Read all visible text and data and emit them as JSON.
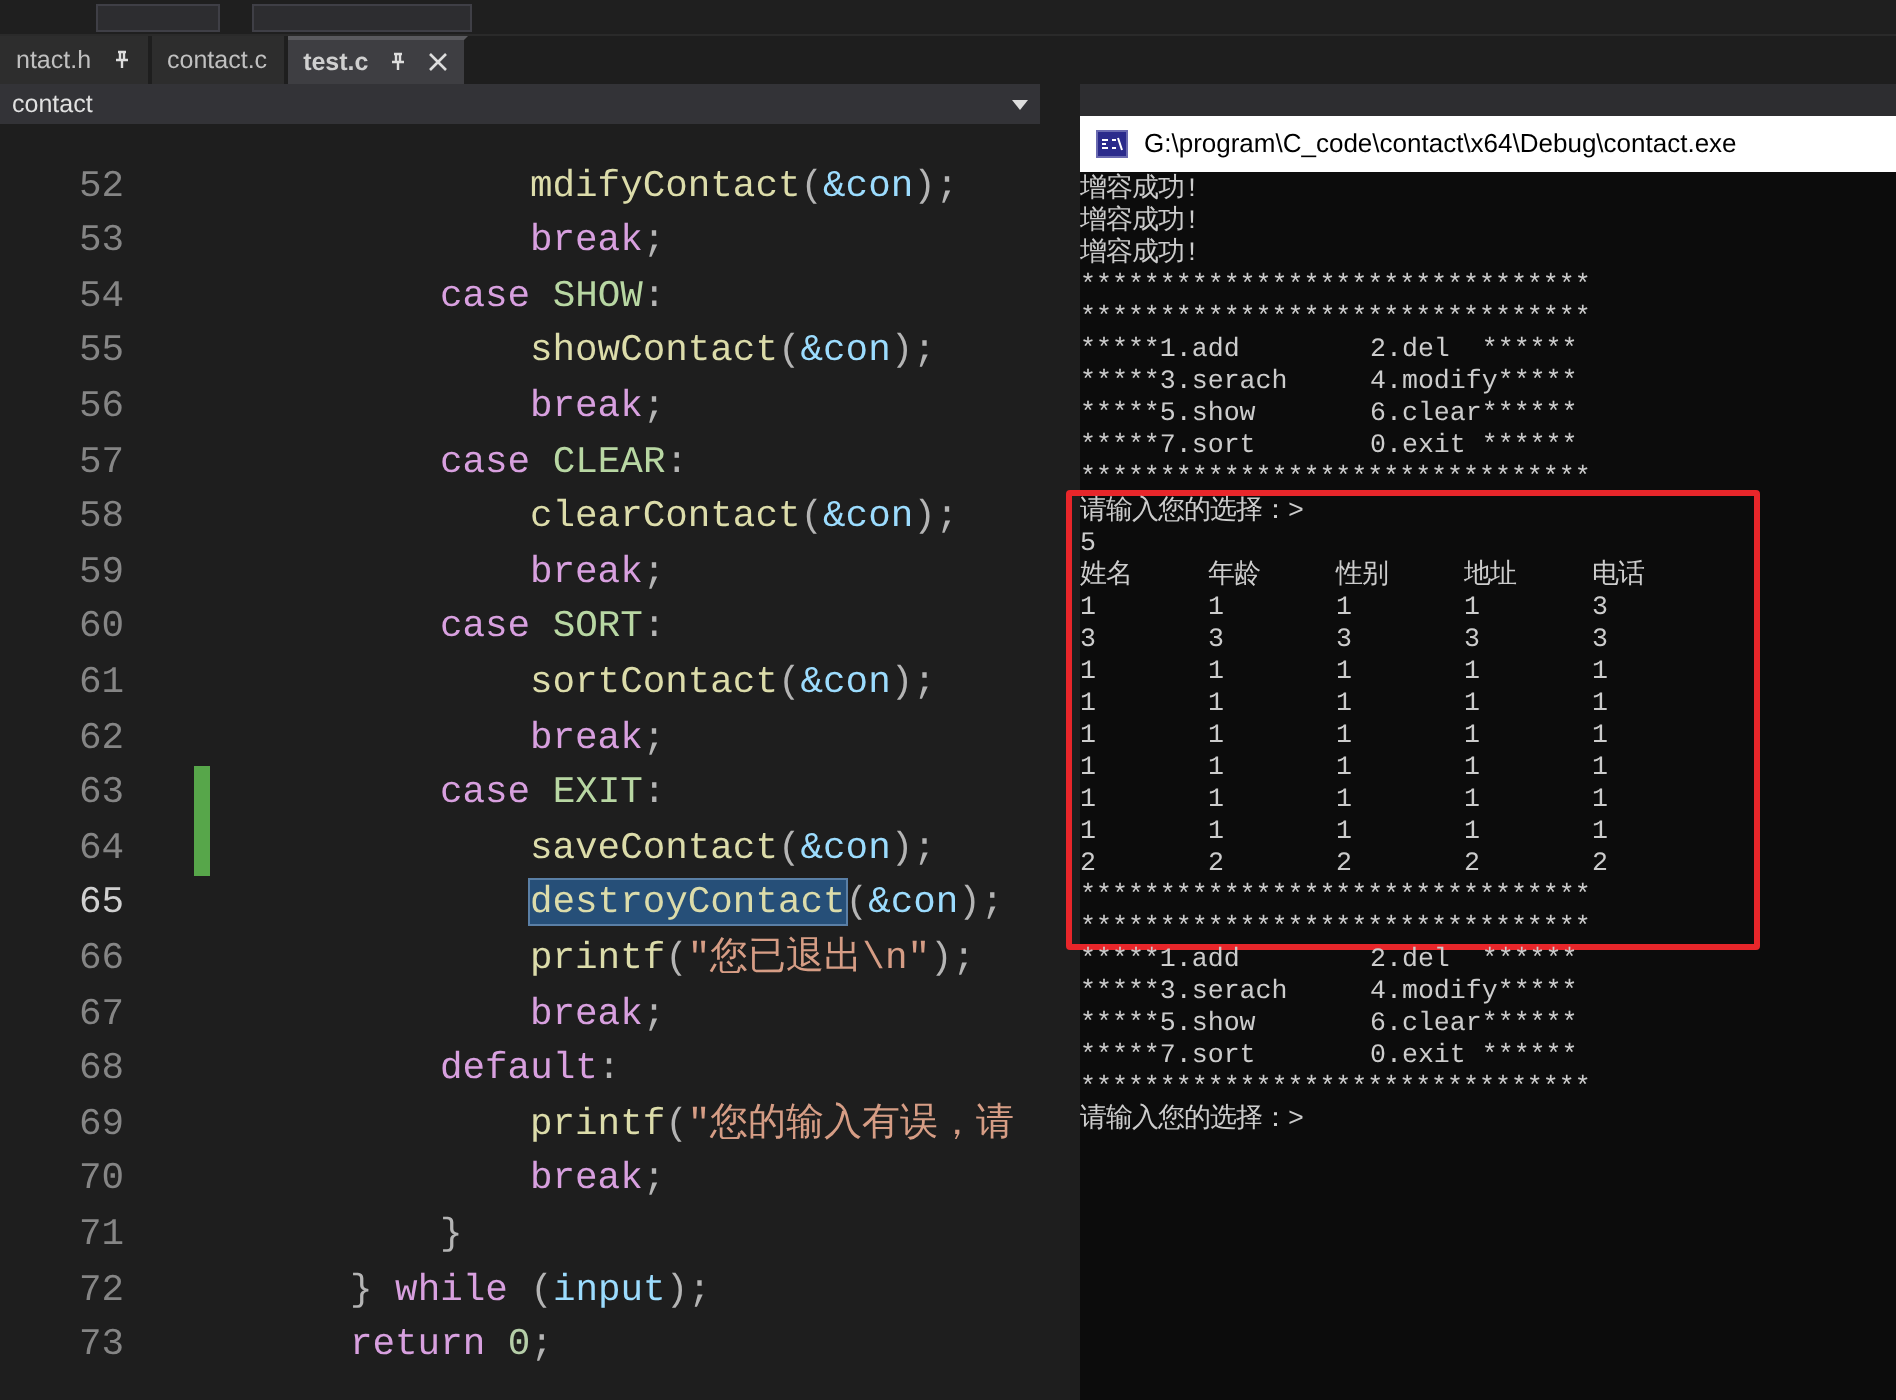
{
  "tabs": [
    {
      "label": "ntact.h",
      "pinned": true,
      "selected": false
    },
    {
      "label": "contact.c",
      "pinned": false,
      "selected": false
    },
    {
      "label": "test.c",
      "pinned": true,
      "selected": true
    }
  ],
  "navigation_bar": {
    "scope": "contact"
  },
  "editor": {
    "lines": [
      {
        "number": "52",
        "current": false,
        "changed": false,
        "kind": "statement",
        "tokens": [
          {
            "t": "mdifyContact",
            "kind": "fn"
          },
          {
            "t": "(",
            "kind": "punct"
          },
          {
            "t": "&con",
            "kind": "var"
          },
          {
            "t": ");",
            "kind": "punct"
          }
        ]
      },
      {
        "number": "53",
        "current": false,
        "changed": false,
        "kind": "statement",
        "tokens": [
          {
            "t": "break",
            "kind": "kw"
          },
          {
            "t": ";",
            "kind": "punct"
          }
        ]
      },
      {
        "number": "54",
        "current": false,
        "changed": false,
        "kind": "label",
        "tokens": [
          {
            "t": "case ",
            "kind": "kw"
          },
          {
            "t": "SHOW",
            "kind": "macro"
          },
          {
            "t": ":",
            "kind": "punct"
          }
        ]
      },
      {
        "number": "55",
        "current": false,
        "changed": false,
        "kind": "statement",
        "tokens": [
          {
            "t": "showContact",
            "kind": "fn"
          },
          {
            "t": "(",
            "kind": "punct"
          },
          {
            "t": "&con",
            "kind": "var"
          },
          {
            "t": ");",
            "kind": "punct"
          }
        ]
      },
      {
        "number": "56",
        "current": false,
        "changed": false,
        "kind": "statement",
        "tokens": [
          {
            "t": "break",
            "kind": "kw"
          },
          {
            "t": ";",
            "kind": "punct"
          }
        ]
      },
      {
        "number": "57",
        "current": false,
        "changed": false,
        "kind": "label",
        "tokens": [
          {
            "t": "case ",
            "kind": "kw"
          },
          {
            "t": "CLEAR",
            "kind": "macro"
          },
          {
            "t": ":",
            "kind": "punct"
          }
        ]
      },
      {
        "number": "58",
        "current": false,
        "changed": false,
        "kind": "statement",
        "tokens": [
          {
            "t": "clearContact",
            "kind": "fn"
          },
          {
            "t": "(",
            "kind": "punct"
          },
          {
            "t": "&con",
            "kind": "var"
          },
          {
            "t": ");",
            "kind": "punct"
          }
        ]
      },
      {
        "number": "59",
        "current": false,
        "changed": false,
        "kind": "statement",
        "tokens": [
          {
            "t": "break",
            "kind": "kw"
          },
          {
            "t": ";",
            "kind": "punct"
          }
        ]
      },
      {
        "number": "60",
        "current": false,
        "changed": false,
        "kind": "label",
        "tokens": [
          {
            "t": "case ",
            "kind": "kw"
          },
          {
            "t": "SORT",
            "kind": "macro"
          },
          {
            "t": ":",
            "kind": "punct"
          }
        ]
      },
      {
        "number": "61",
        "current": false,
        "changed": false,
        "kind": "statement",
        "tokens": [
          {
            "t": "sortContact",
            "kind": "fn"
          },
          {
            "t": "(",
            "kind": "punct"
          },
          {
            "t": "&con",
            "kind": "var"
          },
          {
            "t": ");",
            "kind": "punct"
          }
        ]
      },
      {
        "number": "62",
        "current": false,
        "changed": false,
        "kind": "statement",
        "tokens": [
          {
            "t": "break",
            "kind": "kw"
          },
          {
            "t": ";",
            "kind": "punct"
          }
        ]
      },
      {
        "number": "63",
        "current": false,
        "changed": true,
        "kind": "label",
        "tokens": [
          {
            "t": "case ",
            "kind": "kw"
          },
          {
            "t": "EXIT",
            "kind": "macro"
          },
          {
            "t": ":",
            "kind": "punct"
          }
        ]
      },
      {
        "number": "64",
        "current": false,
        "changed": true,
        "kind": "statement",
        "tokens": [
          {
            "t": "saveContact",
            "kind": "fn"
          },
          {
            "t": "(",
            "kind": "punct"
          },
          {
            "t": "&con",
            "kind": "var"
          },
          {
            "t": ");",
            "kind": "punct"
          }
        ]
      },
      {
        "number": "65",
        "current": true,
        "changed": false,
        "kind": "statement",
        "tokens": [
          {
            "t": "destroyContact",
            "kind": "fn-selected"
          },
          {
            "t": "(",
            "kind": "punct"
          },
          {
            "t": "&con",
            "kind": "var"
          },
          {
            "t": ");",
            "kind": "punct"
          }
        ]
      },
      {
        "number": "66",
        "current": false,
        "changed": false,
        "kind": "statement",
        "tokens": [
          {
            "t": "printf",
            "kind": "fn"
          },
          {
            "t": "(",
            "kind": "punct"
          },
          {
            "t": "\"您已退出\\n\"",
            "kind": "str"
          },
          {
            "t": ");",
            "kind": "punct"
          }
        ]
      },
      {
        "number": "67",
        "current": false,
        "changed": false,
        "kind": "statement",
        "tokens": [
          {
            "t": "break",
            "kind": "kw"
          },
          {
            "t": ";",
            "kind": "punct"
          }
        ]
      },
      {
        "number": "68",
        "current": false,
        "changed": false,
        "kind": "label",
        "tokens": [
          {
            "t": "default",
            "kind": "kw"
          },
          {
            "t": ":",
            "kind": "punct"
          }
        ]
      },
      {
        "number": "69",
        "current": false,
        "changed": false,
        "kind": "statement",
        "tokens": [
          {
            "t": "printf",
            "kind": "fn"
          },
          {
            "t": "(",
            "kind": "punct"
          },
          {
            "t": "\"您的输入有误，请",
            "kind": "str"
          }
        ]
      },
      {
        "number": "70",
        "current": false,
        "changed": false,
        "kind": "statement",
        "tokens": [
          {
            "t": "break",
            "kind": "kw"
          },
          {
            "t": ";",
            "kind": "punct"
          }
        ]
      },
      {
        "number": "71",
        "current": false,
        "changed": false,
        "kind": "label",
        "tokens": [
          {
            "t": "}",
            "kind": "punct"
          }
        ]
      },
      {
        "number": "72",
        "current": false,
        "changed": false,
        "kind": "block",
        "tokens": [
          {
            "t": "} ",
            "kind": "punct"
          },
          {
            "t": "while",
            "kind": "kw"
          },
          {
            "t": " (",
            "kind": "punct"
          },
          {
            "t": "input",
            "kind": "var"
          },
          {
            "t": ");",
            "kind": "punct"
          }
        ]
      },
      {
        "number": "73",
        "current": false,
        "changed": false,
        "kind": "block",
        "tokens": [
          {
            "t": "return ",
            "kind": "kw"
          },
          {
            "t": "0",
            "kind": "num"
          },
          {
            "t": ";",
            "kind": "punct"
          }
        ]
      }
    ]
  },
  "console": {
    "title": "G:\\program\\C_code\\contact\\x64\\Debug\\contact.exe",
    "sections": [
      {
        "boxed": false,
        "lines": [
          {
            "kind": "text",
            "text": "增容成功!"
          },
          {
            "kind": "text",
            "text": "增容成功!"
          },
          {
            "kind": "text",
            "text": "增容成功!"
          },
          {
            "kind": "text",
            "text": "********************************"
          },
          {
            "kind": "text",
            "text": "********************************"
          },
          {
            "kind": "menu",
            "left": "*****1.add",
            "right": "2.del  ******"
          },
          {
            "kind": "menu",
            "left": "*****3.serach",
            "right": "4.modify*****"
          },
          {
            "kind": "menu",
            "left": "*****5.show",
            "right": "6.clear******"
          },
          {
            "kind": "menu",
            "left": "*****7.sort",
            "right": "0.exit ******"
          },
          {
            "kind": "text",
            "text": "********************************"
          }
        ]
      },
      {
        "boxed": true,
        "lines": [
          {
            "kind": "text",
            "text": "请输入您的选择：>"
          },
          {
            "kind": "text",
            "text": "5"
          },
          {
            "kind": "row",
            "cells": [
              "姓名",
              "年龄",
              "性别",
              "地址",
              "电话"
            ]
          },
          {
            "kind": "row",
            "cells": [
              "1",
              "1",
              "1",
              "1",
              "3"
            ]
          },
          {
            "kind": "row",
            "cells": [
              "3",
              "3",
              "3",
              "3",
              "3"
            ]
          },
          {
            "kind": "row",
            "cells": [
              "1",
              "1",
              "1",
              "1",
              "1"
            ]
          },
          {
            "kind": "row",
            "cells": [
              "1",
              "1",
              "1",
              "1",
              "1"
            ]
          },
          {
            "kind": "row",
            "cells": [
              "1",
              "1",
              "1",
              "1",
              "1"
            ]
          },
          {
            "kind": "row",
            "cells": [
              "1",
              "1",
              "1",
              "1",
              "1"
            ]
          },
          {
            "kind": "row",
            "cells": [
              "1",
              "1",
              "1",
              "1",
              "1"
            ]
          },
          {
            "kind": "row",
            "cells": [
              "1",
              "1",
              "1",
              "1",
              "1"
            ]
          },
          {
            "kind": "row",
            "cells": [
              "2",
              "2",
              "2",
              "2",
              "2"
            ]
          },
          {
            "kind": "text",
            "text": "********************************"
          },
          {
            "kind": "text",
            "text": "********************************"
          }
        ]
      },
      {
        "boxed": false,
        "lines": [
          {
            "kind": "menu",
            "left": "*****1.add",
            "right": "2.del  ******"
          },
          {
            "kind": "menu",
            "left": "*****3.serach",
            "right": "4.modify*****"
          },
          {
            "kind": "menu",
            "left": "*****5.show",
            "right": "6.clear******"
          },
          {
            "kind": "menu",
            "left": "*****7.sort",
            "right": "0.exit ******"
          },
          {
            "kind": "text",
            "text": "********************************"
          },
          {
            "kind": "text",
            "text": "请输入您的选择：>"
          }
        ]
      }
    ]
  }
}
